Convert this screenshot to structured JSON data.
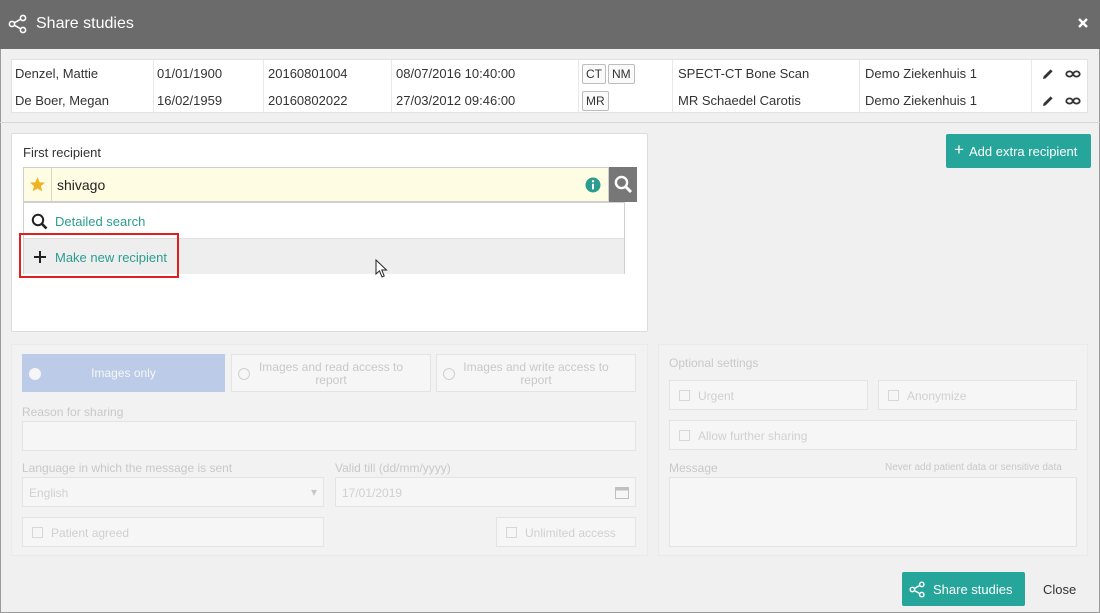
{
  "window": {
    "title": "Share studies",
    "close_icon": "close-x-icon"
  },
  "studies": [
    {
      "name": "Denzel, Mattie",
      "dob": "01/01/1900",
      "accession": "20160801004",
      "datetime": "08/07/2016 10:40:00",
      "modalities": [
        "CT",
        "NM"
      ],
      "description": "SPECT-CT Bone Scan",
      "location": "Demo Ziekenhuis 1"
    },
    {
      "name": "De Boer, Megan",
      "dob": "16/02/1959",
      "accession": "20160802022",
      "datetime": "27/03/2012 09:46:00",
      "modalities": [
        "MR"
      ],
      "description": "MR Schaedel Carotis",
      "location": "Demo Ziekenhuis 1"
    }
  ],
  "recipient": {
    "label": "First recipient",
    "search_value": "shivago",
    "dropdown": {
      "detailed_search": "Detailed search",
      "make_new": "Make new recipient"
    }
  },
  "add_extra_recipient": "Add extra recipient",
  "access": {
    "images_only": "Images only",
    "images_read": "Images and read access to report",
    "images_write": "Images and write access to report"
  },
  "form": {
    "reason_label": "Reason for sharing",
    "language_label": "Language in which the message is sent",
    "language_value": "English",
    "valid_till_label": "Valid till (dd/mm/yyyy)",
    "valid_till_value": "17/01/2019",
    "patient_agreed": "Patient agreed",
    "unlimited_access": "Unlimited access"
  },
  "optional": {
    "title": "Optional settings",
    "urgent": "Urgent",
    "anonymize": "Anonymize",
    "allow_further_sharing": "Allow further sharing",
    "message_label": "Message",
    "message_hint": "Never add patient data or sensitive data"
  },
  "footer": {
    "share": "Share studies",
    "close": "Close"
  },
  "colors": {
    "accent": "#26a69a",
    "titlebar": "#6b6b6b",
    "highlight": "#e0201e",
    "active_toggle": "#7f9fe0"
  }
}
